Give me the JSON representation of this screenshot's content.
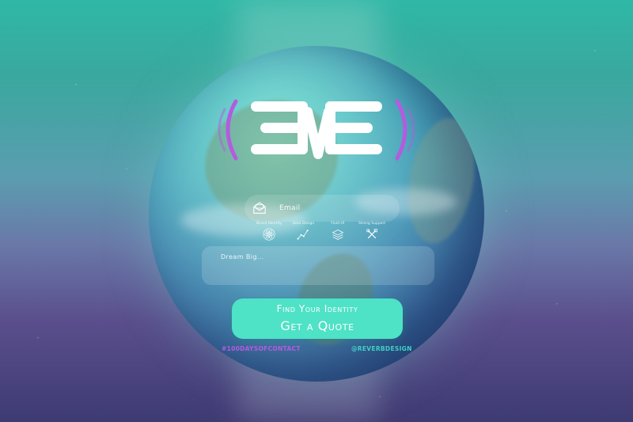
{
  "brand": {
    "logo_text": "EVE",
    "colors": {
      "accent": "#4ee2c6",
      "purple": "#b45be0",
      "teal_text": "#3fd0c6"
    }
  },
  "form": {
    "email_label": "Email",
    "email_icon": "envelope-icon",
    "message_placeholder": "Dream Big..."
  },
  "features": [
    {
      "label": "Brand Identity",
      "icon": "atom-icon"
    },
    {
      "label": "Data Design",
      "icon": "line-chart-icon"
    },
    {
      "label": "Fluid UI",
      "icon": "layers-icon"
    },
    {
      "label": "Strong Support",
      "icon": "tools-icon"
    }
  ],
  "cta": {
    "line1": "Find Your Identity",
    "line2": "Get a Quote"
  },
  "footer": {
    "hashtag": "#100DAYSOFCONTACT",
    "handle": "@REVERBDESIGN"
  }
}
